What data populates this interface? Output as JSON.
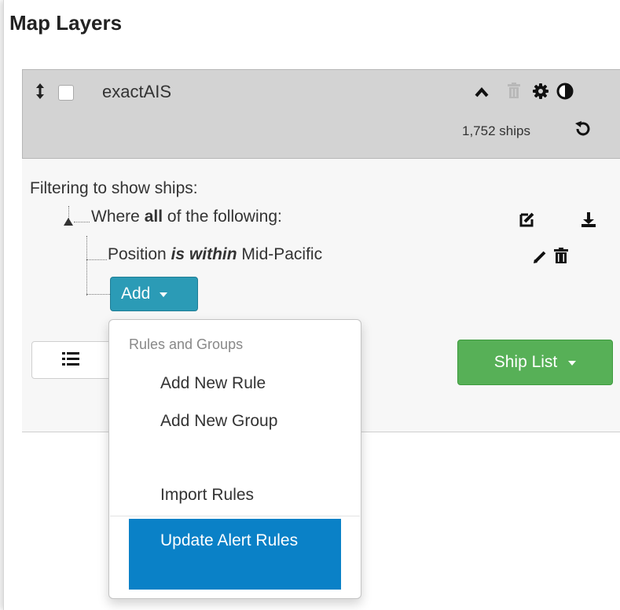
{
  "panel": {
    "title": "Map Layers"
  },
  "layer": {
    "name": "exactAIS",
    "ship_count": "1,752 ships",
    "icons": [
      "drag-handle-icon",
      "caret-up-icon",
      "trash-icon",
      "gear-icon",
      "contrast-icon",
      "refresh-icon"
    ]
  },
  "filter": {
    "caption": "Filtering to show ships:",
    "group": {
      "prefix": "Where",
      "quantifier": "all",
      "suffix": "of the following:"
    },
    "rule": {
      "field": "Position",
      "operator": "is within",
      "value": "Mid-Pacific"
    },
    "add_button": "Add"
  },
  "actions": {
    "ship_list_label": "Ship List"
  },
  "dropdown": {
    "header": "Rules and Groups",
    "items": [
      {
        "label": "Add New Rule"
      },
      {
        "label": "Add New Group"
      },
      {
        "label": "Import Rules"
      },
      {
        "label": "Update Alert Rules",
        "active": true
      }
    ]
  },
  "colors": {
    "add_button": "#2b9bb6",
    "ship_list_button": "#57b057",
    "active_menu_item": "#0a81c7",
    "layer_header": "#d3d3d3"
  }
}
